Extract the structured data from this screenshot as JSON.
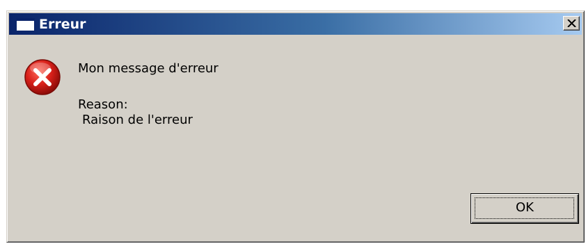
{
  "window": {
    "title": "Erreur",
    "close_glyph": "x",
    "icon": "window-icon"
  },
  "error_icon": {
    "name": "error-icon",
    "color": "#cc1111"
  },
  "message": {
    "main": "Mon message d'erreur",
    "reason_label": "Reason:",
    "reason": "Raison de l'erreur"
  },
  "buttons": {
    "ok_label": "OK"
  },
  "colors": {
    "titlebar_start": "#0a246a",
    "titlebar_end": "#a6caf0",
    "face": "#d4d0c8"
  }
}
